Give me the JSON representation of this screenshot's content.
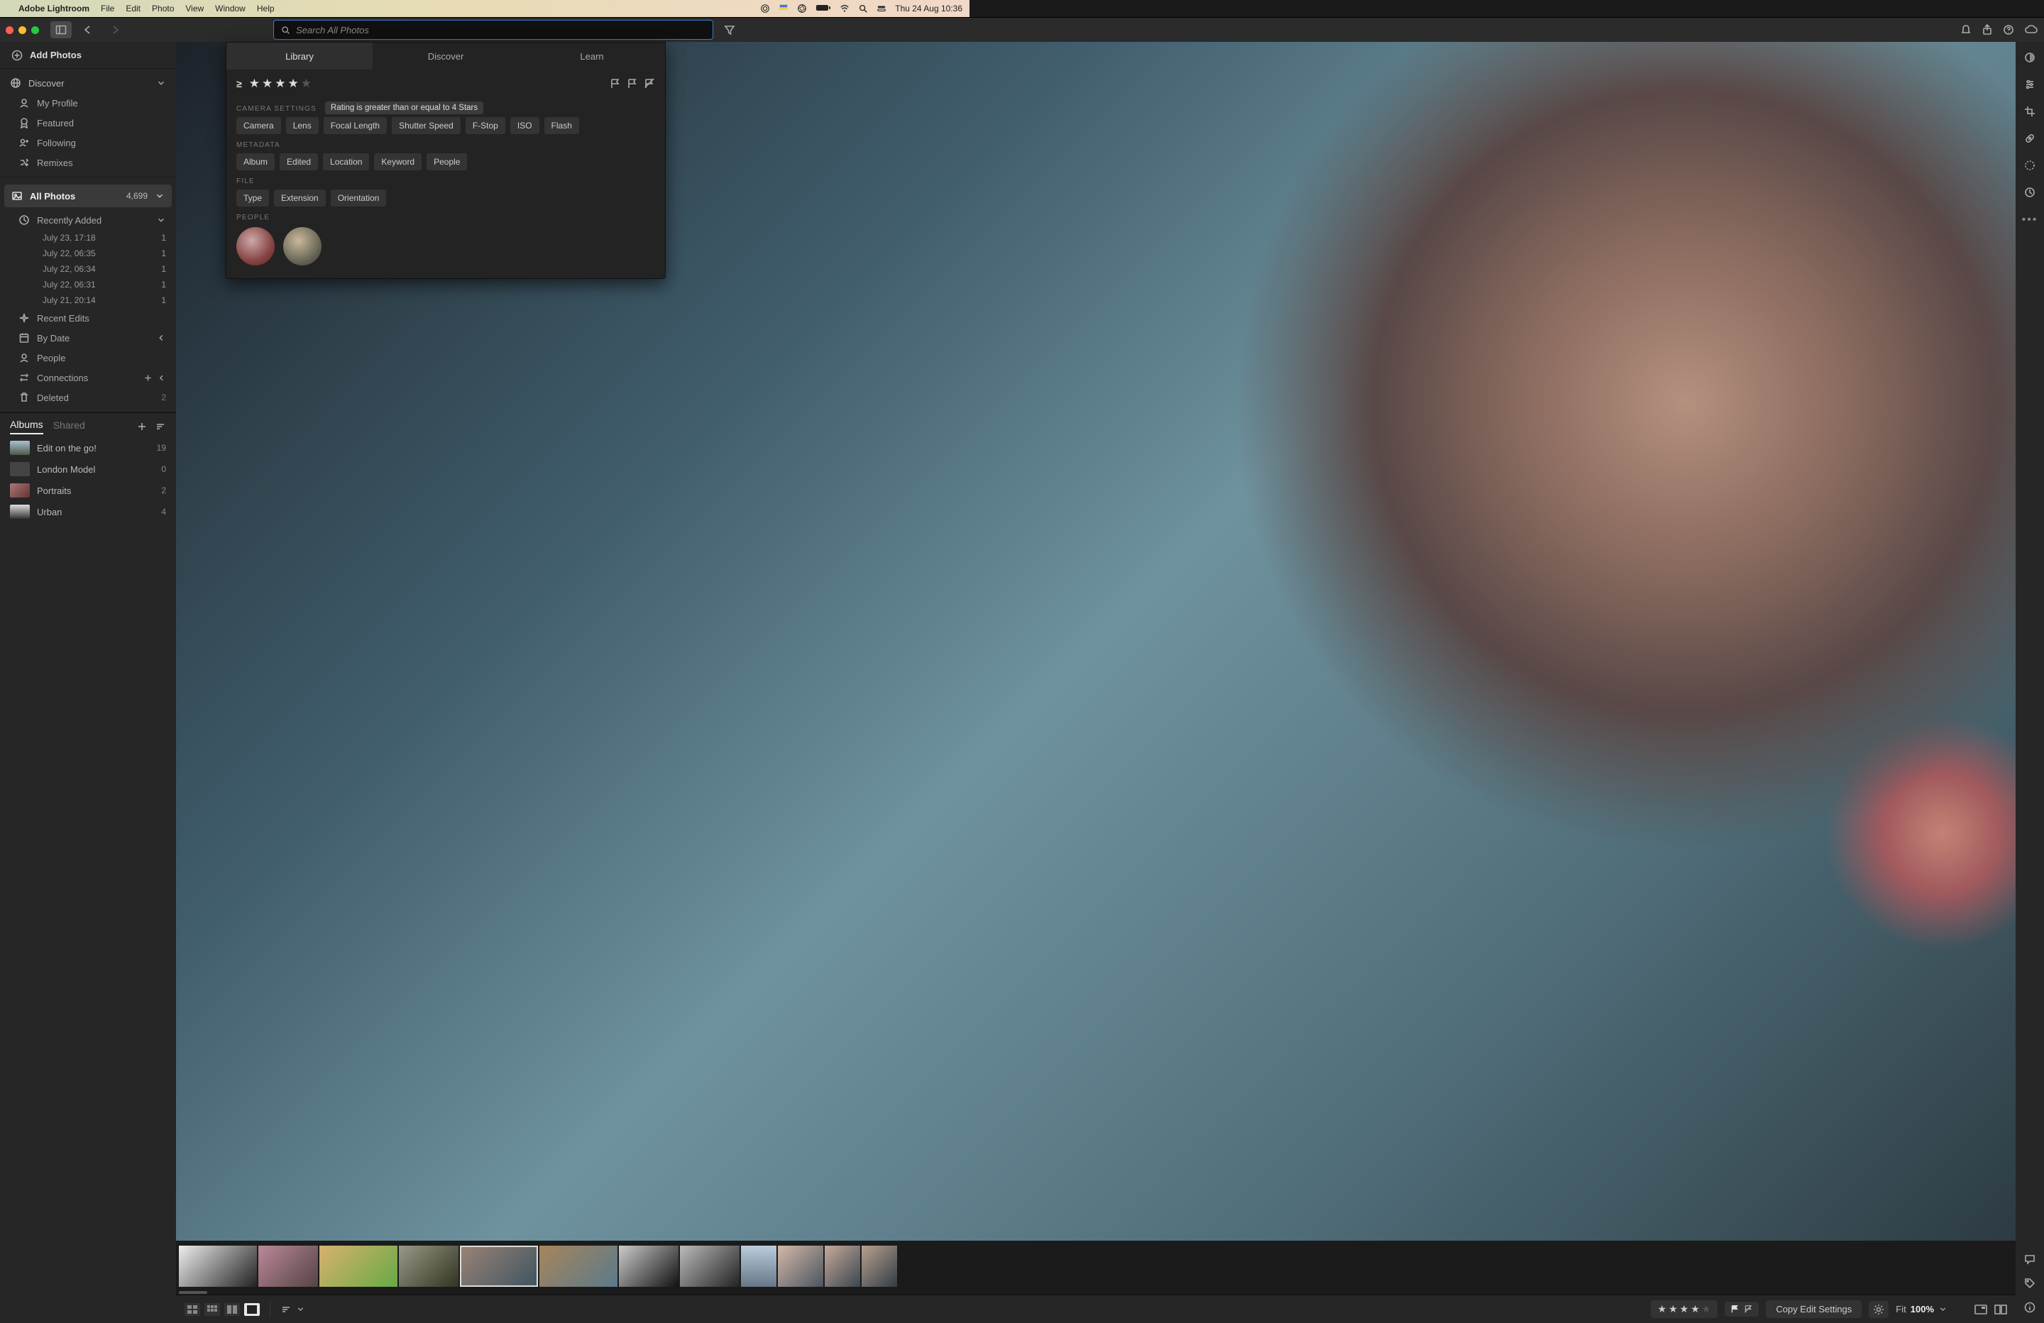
{
  "mac": {
    "app": "Adobe Lightroom",
    "menus": [
      "File",
      "Edit",
      "Photo",
      "View",
      "Window",
      "Help"
    ],
    "clock": "Thu 24 Aug  10:36"
  },
  "search": {
    "placeholder": "Search All Photos"
  },
  "panel": {
    "tabs": [
      "Library",
      "Discover",
      "Learn"
    ],
    "tooltip": "Rating is greater than or equal to 4 Stars",
    "sections": {
      "camera": {
        "label": "CAMERA SETTINGS",
        "chips": [
          "Camera",
          "Lens",
          "Focal Length",
          "Shutter Speed",
          "F-Stop",
          "ISO",
          "Flash"
        ]
      },
      "metadata": {
        "label": "METADATA",
        "chips": [
          "Album",
          "Edited",
          "Location",
          "Keyword",
          "People"
        ]
      },
      "file": {
        "label": "FILE",
        "chips": [
          "Type",
          "Extension",
          "Orientation"
        ]
      },
      "people": {
        "label": "PEOPLE"
      }
    }
  },
  "sidebar": {
    "add": "Add Photos",
    "discover": {
      "label": "Discover",
      "items": [
        {
          "icon": "profile",
          "label": "My Profile"
        },
        {
          "icon": "badge",
          "label": "Featured"
        },
        {
          "icon": "people",
          "label": "Following"
        },
        {
          "icon": "remix",
          "label": "Remixes"
        }
      ]
    },
    "all": {
      "label": "All Photos",
      "count": "4,699"
    },
    "recent": {
      "label": "Recently Added",
      "items": [
        {
          "label": "July 23, 17:18",
          "count": "1"
        },
        {
          "label": "July 22, 06:35",
          "count": "1"
        },
        {
          "label": "July 22, 06:34",
          "count": "1"
        },
        {
          "label": "July 22, 06:31",
          "count": "1"
        },
        {
          "label": "July 21, 20:14",
          "count": "1"
        }
      ]
    },
    "recentEdits": {
      "label": "Recent Edits"
    },
    "byDate": {
      "label": "By Date"
    },
    "people": {
      "label": "People"
    },
    "connections": {
      "label": "Connections"
    },
    "deleted": {
      "label": "Deleted",
      "count": "2"
    }
  },
  "albums": {
    "tabs": [
      "Albums",
      "Shared"
    ],
    "items": [
      {
        "label": "Edit on the go!",
        "count": "19"
      },
      {
        "label": "London Model",
        "count": "0"
      },
      {
        "label": "Portraits",
        "count": "2"
      },
      {
        "label": "Urban",
        "count": "4"
      }
    ]
  },
  "bottom": {
    "copy": "Copy Edit Settings",
    "fit": "Fit",
    "zoom": "100%"
  }
}
